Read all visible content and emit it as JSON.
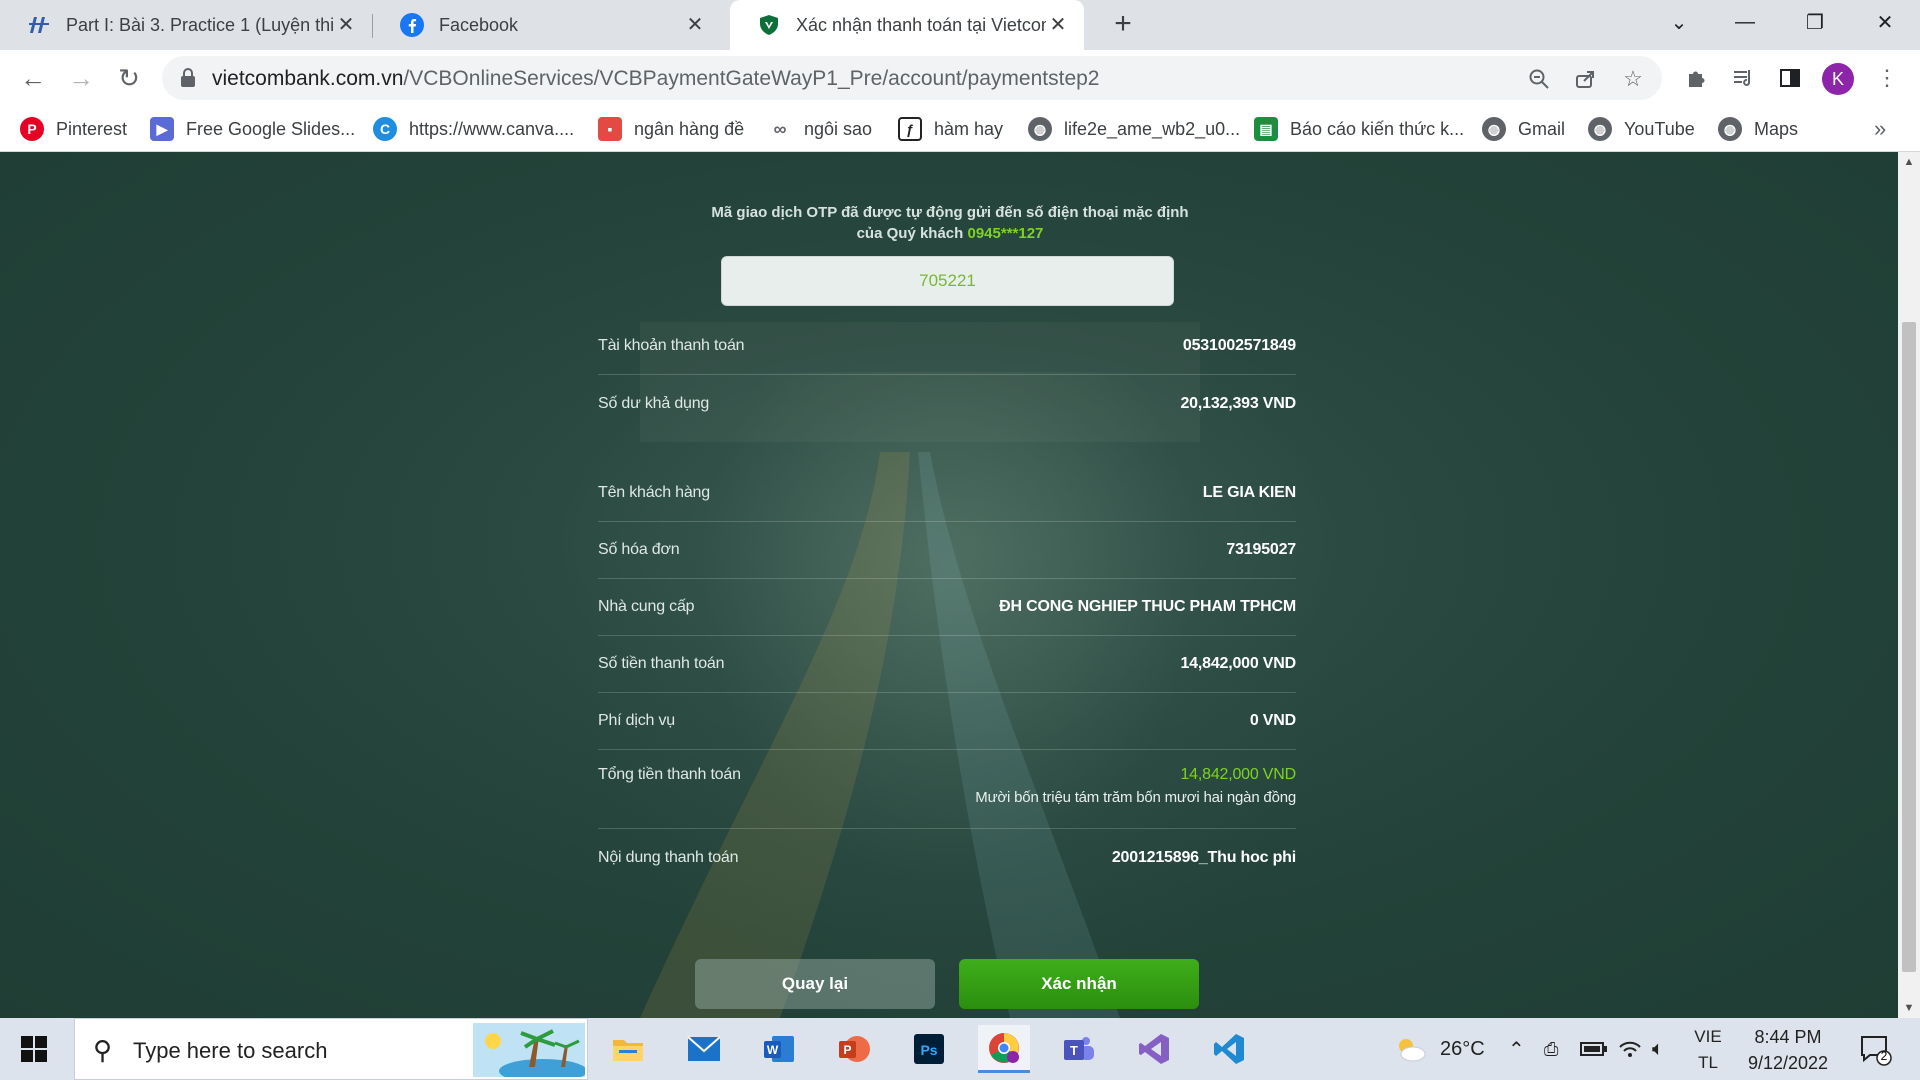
{
  "browser": {
    "tabs": [
      {
        "title": "Part I: Bài 3. Practice 1 (Luyện thi",
        "icon": "site-logo-icon"
      },
      {
        "title": "Facebook",
        "icon": "facebook-icon"
      },
      {
        "title": "Xác nhận thanh toán tại Vietcom",
        "icon": "vietcombank-shield-icon"
      }
    ],
    "url_host": "vietcombank.com.vn",
    "url_path": "/VCBOnlineServices/VCBPaymentGateWayP1_Pre/account/paymentstep2",
    "profile_initial": "K",
    "bookmarks": [
      {
        "label": "Pinterest",
        "color": "#e60023",
        "glyph": "P"
      },
      {
        "label": "Free Google Slides...",
        "color": "#5b6bd6",
        "glyph": "G"
      },
      {
        "label": "https://www.canva....",
        "color": "#1f8ee0",
        "glyph": "C"
      },
      {
        "label": "ngân hàng đề",
        "color": "#e24a43",
        "glyph": "▪"
      },
      {
        "label": "ngôi sao",
        "color": "#5f6368",
        "glyph": "∞"
      },
      {
        "label": "hàm hay",
        "color": "#222222",
        "glyph": "ƒ"
      },
      {
        "label": "life2e_ame_wb2_u0...",
        "color": "#5f6368",
        "glyph": "◍"
      },
      {
        "label": "Báo cáo kiến thức k...",
        "color": "#1e8e3e",
        "glyph": "▤"
      },
      {
        "label": "Gmail",
        "color": "#5f6368",
        "glyph": "◍"
      },
      {
        "label": "YouTube",
        "color": "#5f6368",
        "glyph": "◍"
      },
      {
        "label": "Maps",
        "color": "#5f6368",
        "glyph": "◍"
      }
    ]
  },
  "page": {
    "otp_message_prefix": "Mã giao dịch OTP đã được tự động gửi đến số điện thoại mặc định của Quý khách",
    "otp_phone": "0945***127",
    "otp_value": "705221",
    "details": {
      "account_label": "Tài khoản thanh toán",
      "account_value": "0531002571849",
      "balance_label": "Số dư khả dụng",
      "balance_value": "20,132,393 VND",
      "customer_label": "Tên khách hàng",
      "customer_value": "LE GIA KIEN",
      "invoice_label": "Số hóa đơn",
      "invoice_value": "73195027",
      "provider_label": "Nhà cung cấp",
      "provider_value": "ĐH CONG NGHIEP THUC PHAM TPHCM",
      "amount_label": "Số tiền thanh toán",
      "amount_value": "14,842,000 VND",
      "fee_label": "Phí dịch vụ",
      "fee_value": "0 VND",
      "total_label": "Tổng tiền thanh toán",
      "total_value": "14,842,000 VND",
      "total_words": "Mười bốn triệu tám trăm bốn mươi hai ngàn đồng",
      "content_label": "Nội dung thanh toán",
      "content_value": "2001215896_Thu hoc phi"
    },
    "back_button": "Quay lại",
    "confirm_button": "Xác nhận",
    "accent_color": "#7ed321"
  },
  "taskbar": {
    "search_placeholder": "Type here to search",
    "weather": "26°C",
    "lang_top": "VIE",
    "lang_bottom": "TL",
    "time": "8:44 PM",
    "date": "9/12/2022",
    "notification_count": "2"
  }
}
